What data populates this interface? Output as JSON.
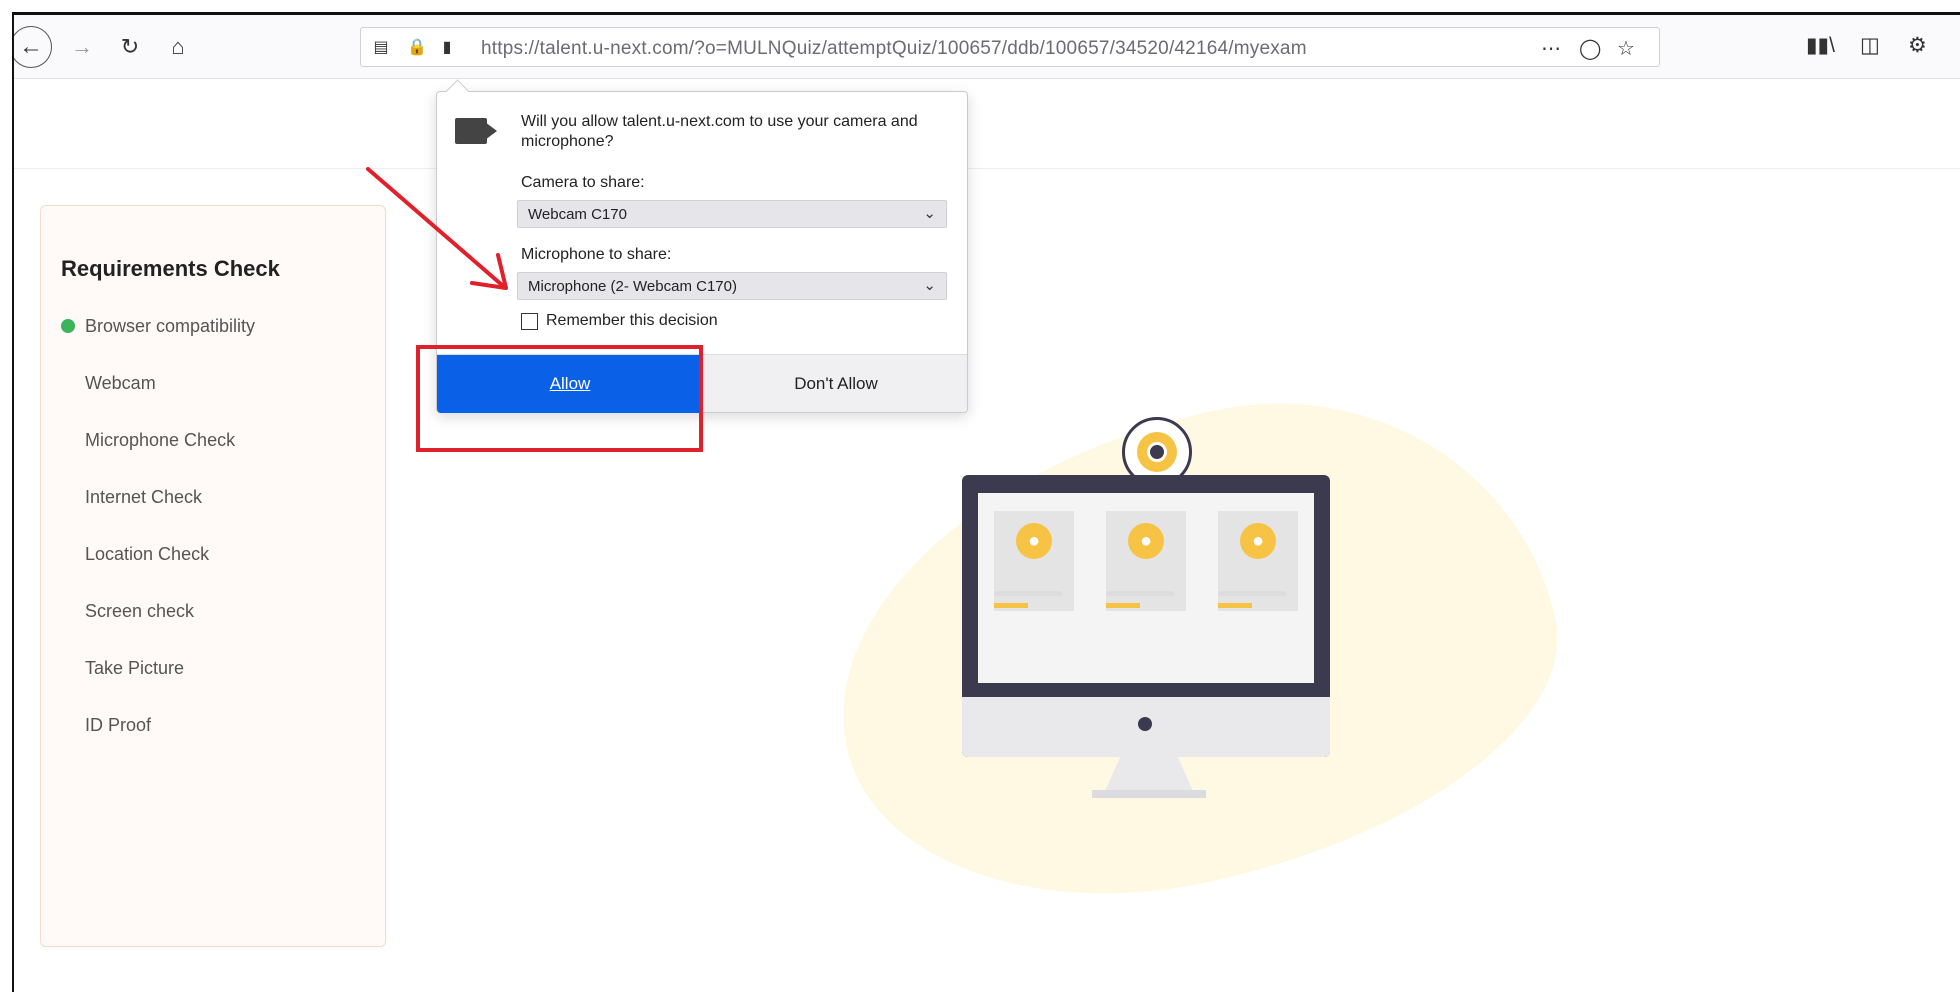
{
  "browser": {
    "url": "https://talent.u-next.com/?o=MULNQuiz/attemptQuiz/100657/ddb/100657/34520/42164/myexam",
    "url_host_bold": "talent.u-next.com",
    "icons": {
      "back": "back-arrow-icon",
      "forward": "forward-arrow-icon",
      "reload": "reload-icon",
      "home": "home-icon",
      "reader": "reader-icon",
      "lock": "lock-icon",
      "camera": "camera-icon",
      "more": "more-icon",
      "pocket": "pocket-icon",
      "bookmark": "star-icon",
      "library": "library-icon",
      "sidebar": "sidebar-icon",
      "extension": "extension-icon"
    }
  },
  "popup": {
    "question": "Will you allow talent.u-next.com to use your camera and microphone?",
    "camera_label": "Camera to share:",
    "camera_value": "Webcam C170",
    "microphone_label": "Microphone to share:",
    "microphone_value": "Microphone (2- Webcam C170)",
    "remember_label": "Remember this decision",
    "allow_label": "Allow",
    "deny_label": "Don't Allow"
  },
  "requirements": {
    "title": "Requirements Check",
    "items": [
      {
        "label": "Browser compatibility",
        "status": "ok"
      },
      {
        "label": "Webcam",
        "status": "pending"
      },
      {
        "label": "Microphone Check",
        "status": "pending"
      },
      {
        "label": "Internet Check",
        "status": "pending"
      },
      {
        "label": "Location Check",
        "status": "pending"
      },
      {
        "label": "Screen check",
        "status": "pending"
      },
      {
        "label": "Take Picture",
        "status": "pending"
      },
      {
        "label": "ID Proof",
        "status": "pending"
      }
    ]
  },
  "colors": {
    "allow_button": "#0a60e6",
    "annotation_red": "#e0202a",
    "success_green": "#3cb55a",
    "accent_yellow": "#f6c344"
  }
}
